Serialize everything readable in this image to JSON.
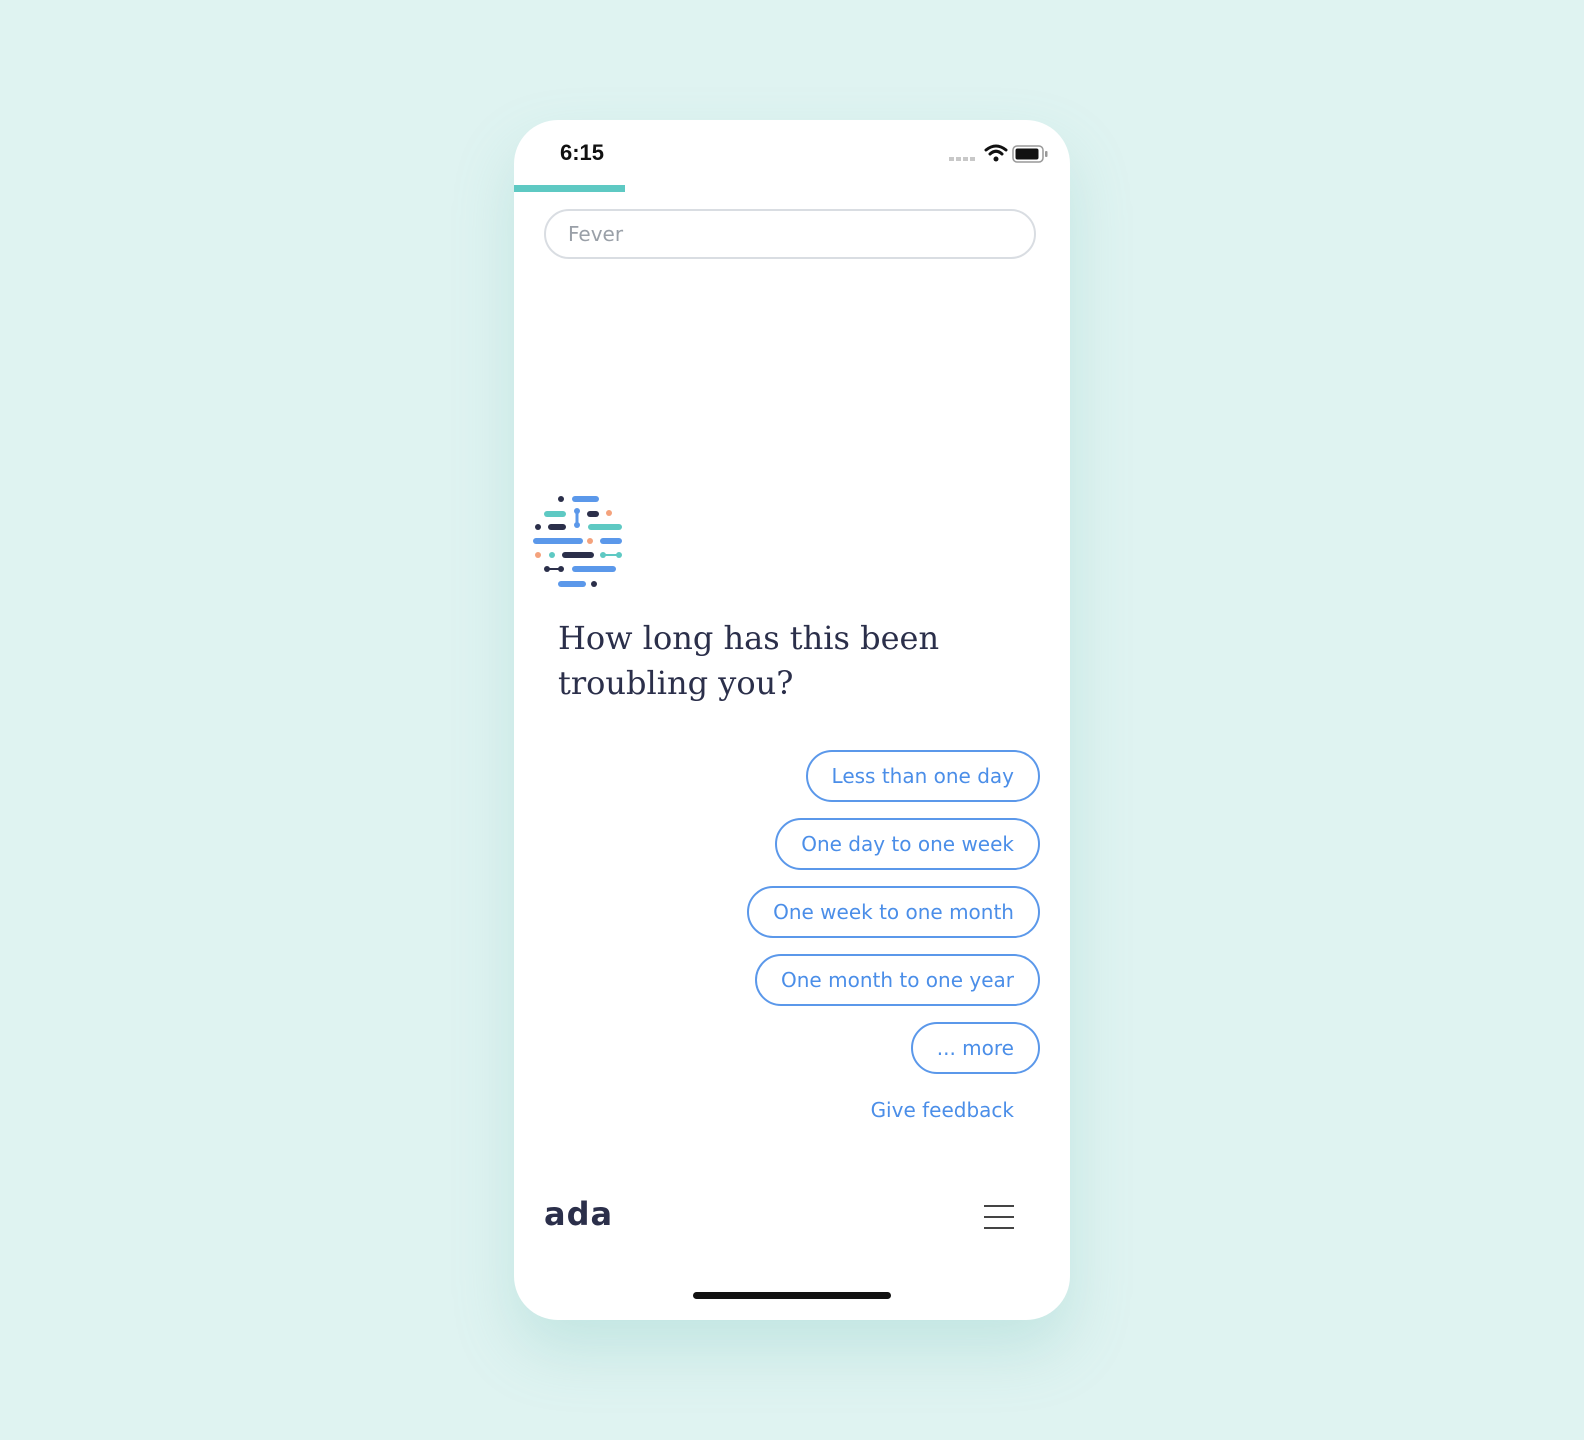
{
  "status_bar": {
    "time": "6:15",
    "signal_icon": "cellular-signal-icon",
    "wifi_icon": "wifi-icon",
    "battery_icon": "battery-icon"
  },
  "progress": {
    "fraction": 0.2
  },
  "search": {
    "placeholder": "Fever"
  },
  "assistant": {
    "avatar_icon": "ada-chatbot-avatar-icon",
    "question": "How long has this been troubling you?"
  },
  "answers": [
    "Less than one day",
    "One day to one week",
    "One week to one month",
    "One month to one year",
    "... more"
  ],
  "feedback_label": "Give feedback",
  "footer": {
    "logo": "ada",
    "menu_icon": "hamburger-menu-icon"
  },
  "colors": {
    "background": "#dff3f1",
    "accent_teal": "#5ec9c3",
    "accent_blue": "#4b8ee8",
    "text_dark": "#2b2f4a",
    "accent_orange": "#f4a27c"
  }
}
